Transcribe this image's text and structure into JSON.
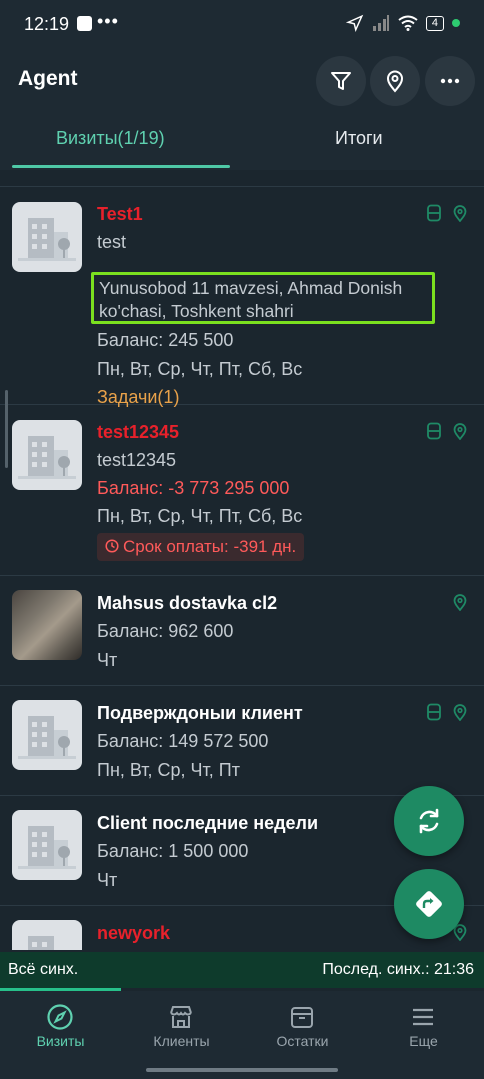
{
  "status_bar": {
    "time": "12:19",
    "dots": "•••",
    "battery": "4"
  },
  "app": {
    "title": "Agent"
  },
  "tabs": [
    {
      "label": "Визиты(1/19)"
    },
    {
      "label": "Итоги"
    }
  ],
  "clients": [
    {
      "name": "Test1",
      "name_color": "red",
      "subtitle": "test",
      "address_line1": "Yunusobod 11 mavzesi, Ahmad Donish",
      "address_line2": "ko'chasi, Toshkent shahri",
      "balance": "Баланс: 245 500",
      "days": "Пн, Вт, Ср, Чт, Пт, Сб, Вс",
      "tasks": "Задачи(1)",
      "icons": [
        "db-icon",
        "pin-icon"
      ]
    },
    {
      "name": "test12345",
      "name_color": "red",
      "subtitle": "test12345",
      "balance": "Баланс: -3 773 295 000",
      "days": "Пн, Вт, Ср, Чт, Пт, Сб, Вс",
      "due": "Срок оплаты: -391 дн.",
      "icons": [
        "db-icon",
        "pin-icon"
      ]
    },
    {
      "name": "Mahsus dostavka cl2",
      "name_color": "white",
      "balance": "Баланс: 962 600",
      "days": "Чт",
      "icons": [
        "pin-icon"
      ]
    },
    {
      "name": "Подверждоныи клиент",
      "name_color": "white",
      "balance": "Баланс: 149 572 500",
      "days": "Пн, Вт, Ср, Чт, Пт",
      "icons": [
        "db-icon",
        "pin-icon"
      ]
    },
    {
      "name": "Client последние недели",
      "name_color": "white",
      "balance": "Баланс: 1 500 000",
      "days": "Чт",
      "icons": []
    },
    {
      "name": "newyork",
      "name_color": "red",
      "icons": [
        "pin-icon"
      ]
    }
  ],
  "sync": {
    "status": "Всё синх.",
    "last": "Послед. синх.: 21:36",
    "progress": 0.25
  },
  "bottom_nav": [
    {
      "label": "Визиты",
      "active": true
    },
    {
      "label": "Клиенты"
    },
    {
      "label": "Остатки"
    },
    {
      "label": "Еще"
    }
  ],
  "colors": {
    "accent": "#4fc9a7",
    "danger": "#e8212b",
    "fab": "#1e8a63",
    "highlight": "#7be01f"
  }
}
